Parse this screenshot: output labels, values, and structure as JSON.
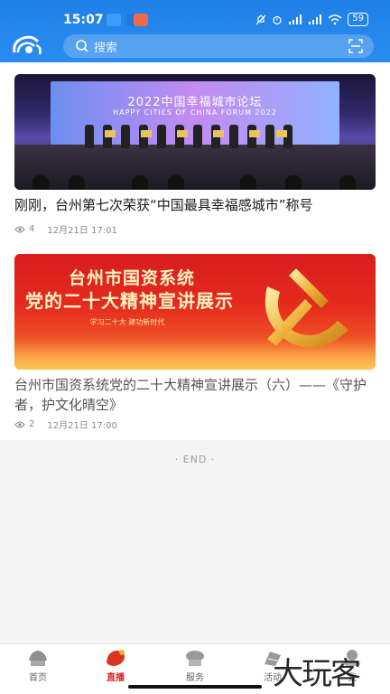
{
  "status_bar": {
    "time": "15:07",
    "battery": "59"
  },
  "search": {
    "placeholder": "搜索"
  },
  "feed": [
    {
      "image_caption_title": "2022中国幸福城市论坛",
      "image_caption_subtitle": "HAPPY CITIES OF CHINA FORUM 2022",
      "title": "刚刚，台州第七次荣获“中国最具幸福感城市”称号",
      "views": "4",
      "date": "12月21日 17:01"
    },
    {
      "image_caption_line1": "台州市国资系统",
      "image_caption_line2": "党的二十大精神宣讲展示",
      "image_slogan": "学习二十大  建功新时代",
      "title": "台州市国资系统党的二十大精神宣讲展示（六）——《守护者，护文化晴空》",
      "views": "2",
      "date": "12月21日 17:00"
    }
  ],
  "end_label": "· END ·",
  "bottom_nav": [
    {
      "label": "首页",
      "icon": "home-icon",
      "active": false
    },
    {
      "label": "直播",
      "icon": "live-icon",
      "active": true
    },
    {
      "label": "服务",
      "icon": "service-icon",
      "active": false
    },
    {
      "label": "活动",
      "icon": "activity-icon",
      "active": false
    },
    {
      "label": "我",
      "icon": "me-icon",
      "active": false
    }
  ],
  "watermark": "大玩客",
  "colors": {
    "header": "#1f7fe6",
    "active_nav": "#dd2222"
  }
}
